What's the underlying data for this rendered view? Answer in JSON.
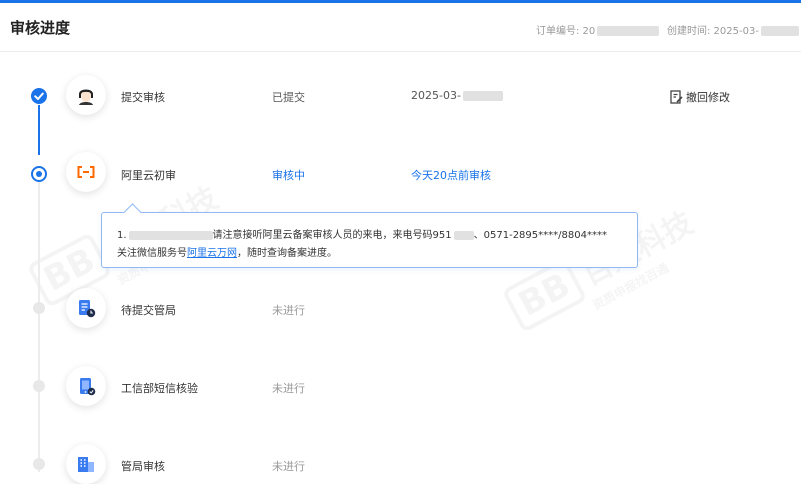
{
  "header": {
    "title": "审核进度",
    "order_label": "订单编号: 20",
    "created_label": "创建时间: 2025-03-"
  },
  "steps": [
    {
      "name": "提交审核",
      "status": "已提交",
      "time": "2025-03-"
    },
    {
      "name": "阿里云初审",
      "status": "审核中",
      "time": "今天20点前审核"
    },
    {
      "name": "待提交管局",
      "status": "未进行"
    },
    {
      "name": "工信部短信核验",
      "status": "未进行"
    },
    {
      "name": "管局审核",
      "status": "未进行"
    }
  ],
  "revoke_label": "撤回修改",
  "notice": {
    "prefix": "1.",
    "line1_main": "请注意接听阿里云备案审核人员的来电，来电号码951",
    "line1_tail": "、0571-2895****/8804****",
    "line2_prefix": "关注微信服务号",
    "line2_link": "阿里云万网",
    "line2_suffix": "，随时查询备案进度。"
  },
  "watermark": {
    "logo": "BB",
    "text": "百通科技",
    "sub": "资质申报找百通"
  },
  "colors": {
    "accent": "#1a73e8",
    "pending_node": "#e8e8e8",
    "muted_text": "#999999"
  },
  "icons": {
    "step1": "user-avatar-icon",
    "step2": "aliyun-logo-icon",
    "step3": "document-clock-icon",
    "step4": "phone-message-icon",
    "step5": "building-icon",
    "revoke": "edit-document-icon",
    "done_node": "checkmark-icon"
  }
}
